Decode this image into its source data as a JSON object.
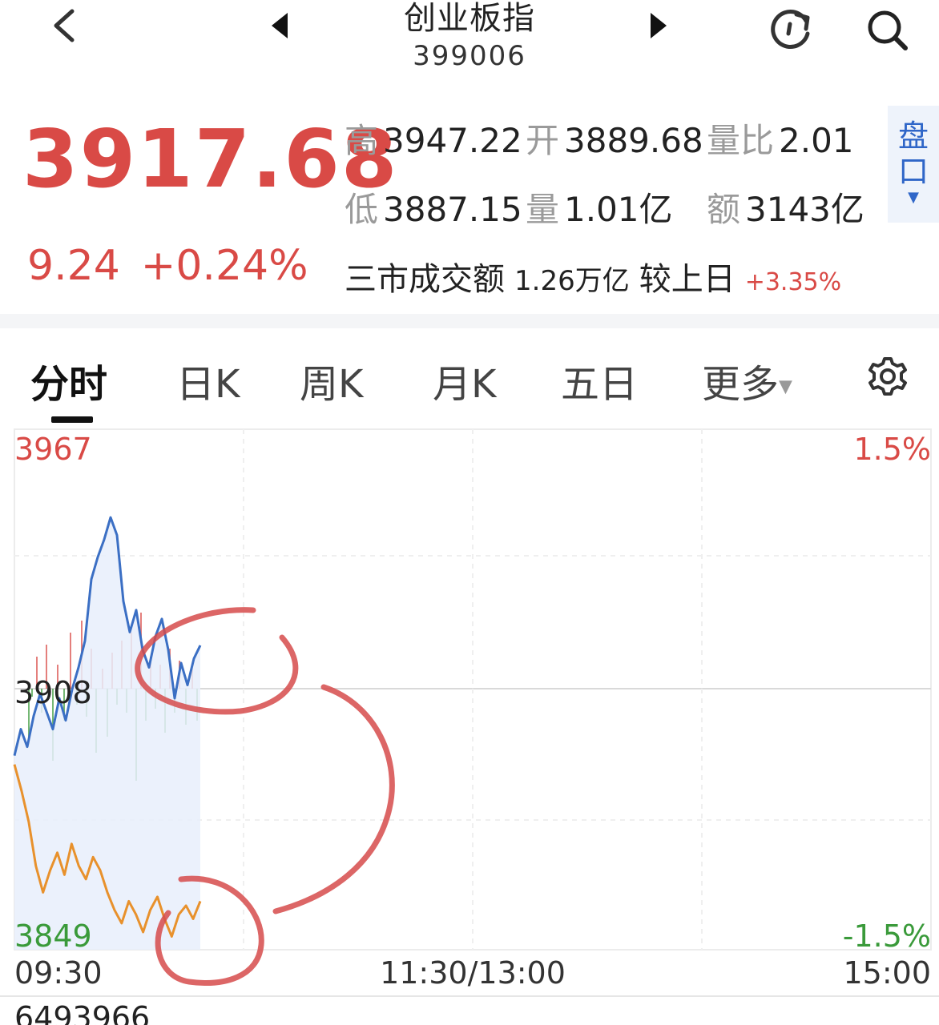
{
  "header": {
    "title": "创业板指",
    "code": "399006"
  },
  "quote": {
    "price": "3917.68",
    "change": "9.24",
    "change_pct": "+0.24%",
    "high_label": "高",
    "high": "3947.22",
    "open_label": "开",
    "open": "3889.68",
    "vol_ratio_label": "量比",
    "vol_ratio": "2.01",
    "low_label": "低",
    "low": "3887.15",
    "volume_label": "量",
    "volume": "1.01亿",
    "amount_label": "额",
    "amount": "3143亿",
    "market_turnover_label": "三市成交额",
    "market_turnover": "1.26万亿",
    "vs_prev_label": "较上日",
    "vs_prev": "+3.35%",
    "pankou_label_1": "盘",
    "pankou_label_2": "口"
  },
  "tabs": [
    {
      "label": "分时",
      "active": true
    },
    {
      "label": "日K"
    },
    {
      "label": "周K"
    },
    {
      "label": "月K"
    },
    {
      "label": "五日"
    },
    {
      "label": "更多"
    }
  ],
  "chart_labels": {
    "y_top": "3967",
    "y_mid": "3908",
    "y_bottom": "3849",
    "pct_top": "1.5%",
    "pct_bottom": "-1.5%",
    "t_start": "09:30",
    "t_mid": "11:30/13:00",
    "t_end": "15:00",
    "volume_value": "6493966"
  },
  "colors": {
    "up": "#d94a46",
    "down": "#3a9a3a",
    "index_line": "#3b6fc4",
    "avg_line": "#e8912c",
    "annotation": "#d64b4b"
  },
  "chart_data": {
    "type": "line",
    "x_range": [
      "09:30",
      "15:00"
    ],
    "ylim": [
      3849,
      3967
    ],
    "series": [
      {
        "values": [
          3893,
          3899,
          3895,
          3902,
          3907,
          3903,
          3899,
          3906,
          3901,
          3908,
          3913,
          3919,
          3933,
          3938,
          3942,
          3947,
          3943,
          3928,
          3921,
          3926,
          3917,
          3913,
          3920,
          3924,
          3917,
          3906,
          3914,
          3909,
          3915,
          3918
        ]
      },
      {
        "values": [
          3891,
          3885,
          3878,
          3868,
          3862,
          3867,
          3871,
          3866,
          3873,
          3868,
          3865,
          3870,
          3867,
          3862,
          3858,
          3855,
          3860,
          3857,
          3853,
          3858,
          3861,
          3856,
          3852,
          3857,
          3859,
          3856,
          3860
        ]
      }
    ]
  }
}
